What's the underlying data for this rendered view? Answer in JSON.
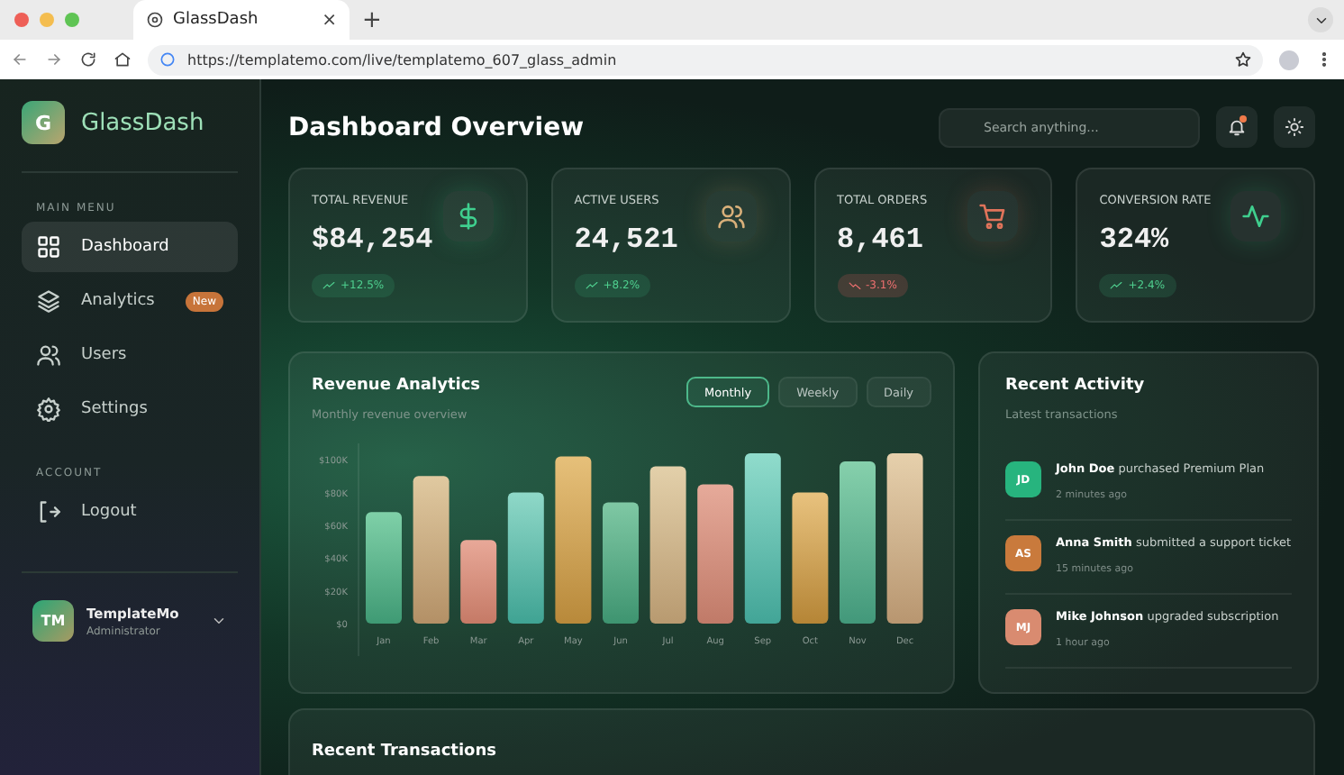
{
  "browser": {
    "tab_title": "GlassDash",
    "new_tab": "+",
    "close": "×",
    "url": "https://templatemo.com/live/templatemo_607_glass_admin"
  },
  "sidebar": {
    "logo_letter": "G",
    "brand": "GlassDash",
    "sections": [
      {
        "label": "MAIN MENU",
        "items": [
          {
            "label": "Dashboard",
            "selected": true
          },
          {
            "label": "Analytics",
            "selected": false,
            "badge": "New"
          },
          {
            "label": "Users",
            "selected": false
          },
          {
            "label": "Settings",
            "selected": false
          }
        ]
      },
      {
        "label": "ACCOUNT",
        "items": [
          {
            "label": "Logout",
            "selected": false
          }
        ]
      }
    ],
    "user": {
      "initials": "TM",
      "name": "TemplateMo",
      "role": "Administrator"
    }
  },
  "header": {
    "title": "Dashboard Overview",
    "search": {
      "placeholder": "Search anything..."
    },
    "notification": true
  },
  "stats": [
    {
      "label": "TOTAL REVENUE",
      "value": "$84,254",
      "change": "+12.5%",
      "negative": false,
      "color": "#3fcf8e"
    },
    {
      "label": "ACTIVE USERS",
      "value": "24,521",
      "change": "+8.2%",
      "negative": false,
      "color": "#d9b07a"
    },
    {
      "label": "TOTAL ORDERS",
      "value": "8,461",
      "change": "-3.1%",
      "negative": true,
      "color": "#e0735a"
    },
    {
      "label": "CONVERSION RATE",
      "value": "324%",
      "change": "+2.4%",
      "negative": false,
      "color": "#3fcf8e"
    }
  ],
  "revenue": {
    "title": "Revenue Analytics",
    "subtitle": "Monthly revenue overview",
    "periods": [
      {
        "label": "Monthly",
        "selected": true
      },
      {
        "label": "Weekly",
        "selected": false
      },
      {
        "label": "Daily",
        "selected": false
      }
    ],
    "chart_data": {
      "type": "bar",
      "categories": [
        "Jan",
        "Feb",
        "Mar",
        "Apr",
        "May",
        "Jun",
        "Jul",
        "Aug",
        "Sep",
        "Oct",
        "Nov",
        "Dec"
      ],
      "series": [
        {
          "values": [
            68,
            90,
            51,
            80,
            102,
            74,
            96,
            85,
            104,
            80,
            99,
            104
          ]
        }
      ],
      "ylim": [
        0,
        110
      ],
      "yticks": [
        {
          "value": 100,
          "label": "$100K"
        },
        {
          "value": 80,
          "label": "$80K"
        },
        {
          "value": 60,
          "label": "$60K"
        },
        {
          "value": 40,
          "label": "$40K"
        },
        {
          "value": 20,
          "label": "$20K"
        },
        {
          "value": 0,
          "label": "$0"
        }
      ]
    }
  },
  "activity": {
    "title": "Recent Activity",
    "subtitle": "Latest transactions",
    "items": [
      {
        "initials": "JD",
        "name": "John Doe",
        "action": "purchased Premium Plan",
        "time": "2 minutes ago",
        "color": "#27b47e"
      },
      {
        "initials": "AS",
        "name": "Anna Smith",
        "action": "submitted a support ticket",
        "time": "15 minutes ago",
        "color": "#c97a3c"
      },
      {
        "initials": "MJ",
        "name": "Mike Johnson",
        "action": "upgraded subscription",
        "time": "1 hour ago",
        "color": "#d98b70"
      }
    ]
  },
  "transactions": {
    "title": "Recent Transactions"
  }
}
